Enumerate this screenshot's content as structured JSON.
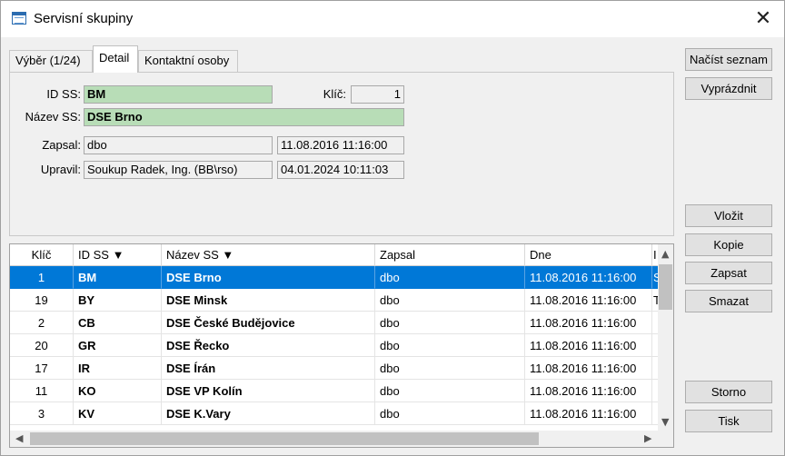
{
  "window": {
    "title": "Servisní skupiny",
    "close_label": "✕"
  },
  "tabs": [
    {
      "label": "Výběr (1/24)"
    },
    {
      "label": "Detail"
    },
    {
      "label": "Kontaktní osoby"
    }
  ],
  "detail": {
    "id_ss_label": "ID SS:",
    "id_ss_value": "BM",
    "klic_label": "Klíč:",
    "klic_value": "1",
    "nazev_label": "Název SS:",
    "nazev_value": "DSE Brno",
    "zapsal_label": "Zapsal:",
    "zapsal_value": "dbo",
    "zapsal_date": "11.08.2016 11:16:00",
    "upravil_label": "Upravil:",
    "upravil_value": "Soukup Radek, Ing. (BB\\rso)",
    "upravil_date": "04.01.2024 10:11:03"
  },
  "buttons": {
    "nacist": "Načíst seznam",
    "vyprazdnit": "Vyprázdnit",
    "vlozit": "Vložit",
    "kopie": "Kopie",
    "zapsat": "Zapsat",
    "smazat": "Smazat",
    "storno": "Storno",
    "tisk": "Tisk"
  },
  "grid": {
    "headers": {
      "klic": "Klíč",
      "id": "ID SS ▼",
      "nazev": "Název SS ▼",
      "zapsal": "Zapsal",
      "dne": "Dne",
      "extra": "I"
    },
    "rows": [
      {
        "klic": "1",
        "id": "BM",
        "nazev": "DSE Brno",
        "zapsal": "dbo",
        "dne": "11.08.2016 11:16:00",
        "extra": "S"
      },
      {
        "klic": "19",
        "id": "BY",
        "nazev": "DSE Minsk",
        "zapsal": "dbo",
        "dne": "11.08.2016 11:16:00",
        "extra": "T"
      },
      {
        "klic": "2",
        "id": "CB",
        "nazev": "DSE České Budějovice",
        "zapsal": "dbo",
        "dne": "11.08.2016 11:16:00",
        "extra": ""
      },
      {
        "klic": "20",
        "id": "GR",
        "nazev": "DSE Řecko",
        "zapsal": "dbo",
        "dne": "11.08.2016 11:16:00",
        "extra": ""
      },
      {
        "klic": "17",
        "id": "IR",
        "nazev": "DSE Írán",
        "zapsal": "dbo",
        "dne": "11.08.2016 11:16:00",
        "extra": ""
      },
      {
        "klic": "11",
        "id": "KO",
        "nazev": "DSE VP Kolín",
        "zapsal": "dbo",
        "dne": "11.08.2016 11:16:00",
        "extra": ""
      },
      {
        "klic": "3",
        "id": "KV",
        "nazev": "DSE K.Vary",
        "zapsal": "dbo",
        "dne": "11.08.2016 11:16:00",
        "extra": ""
      }
    ]
  },
  "colors": {
    "selection": "#0078d7",
    "green_field": "#b8ddb7",
    "window_bg": "#f0f0f0"
  }
}
